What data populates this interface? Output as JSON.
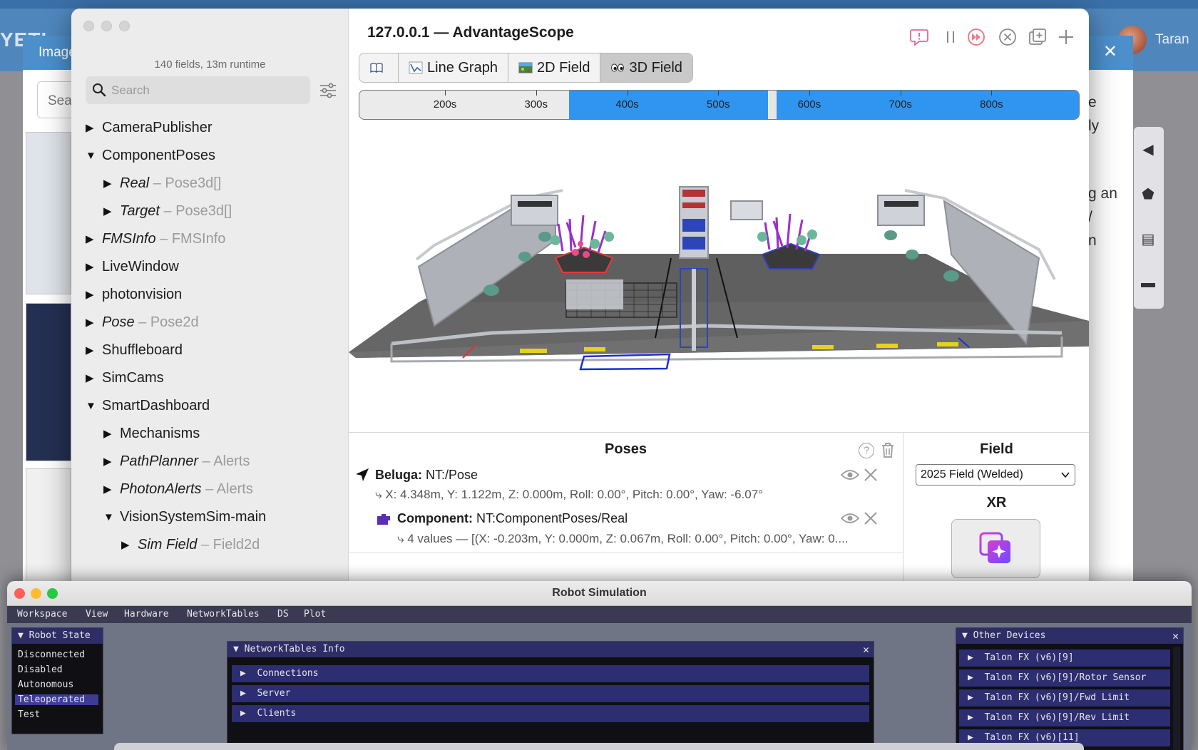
{
  "background_page": {
    "logo": "YETI",
    "user_name": "Taran",
    "modal_title": "Image",
    "modal_close": "✕",
    "search_placeholder": "Sea",
    "right_texts": [
      "e",
      "ly",
      "g an",
      "/",
      "n"
    ]
  },
  "advantagescope": {
    "title": "127.0.0.1 — AdvantageScope",
    "summary": "140 fields, 13m runtime",
    "search_placeholder": "Search",
    "tree": [
      {
        "name": "CameraPublisher",
        "type": "",
        "italic": false,
        "expanded": false,
        "depth": 0
      },
      {
        "name": "ComponentPoses",
        "type": "",
        "italic": false,
        "expanded": true,
        "depth": 0
      },
      {
        "name": "Real",
        "type": "– Pose3d[]",
        "italic": true,
        "expanded": false,
        "depth": 1
      },
      {
        "name": "Target",
        "type": "– Pose3d[]",
        "italic": true,
        "expanded": false,
        "depth": 1
      },
      {
        "name": "FMSInfo",
        "type": "– FMSInfo",
        "italic": true,
        "expanded": false,
        "depth": 0
      },
      {
        "name": "LiveWindow",
        "type": "",
        "italic": false,
        "expanded": false,
        "depth": 0
      },
      {
        "name": "photonvision",
        "type": "",
        "italic": false,
        "expanded": false,
        "depth": 0
      },
      {
        "name": "Pose",
        "type": "– Pose2d",
        "italic": true,
        "expanded": false,
        "depth": 0
      },
      {
        "name": "Shuffleboard",
        "type": "",
        "italic": false,
        "expanded": false,
        "depth": 0
      },
      {
        "name": "SimCams",
        "type": "",
        "italic": false,
        "expanded": false,
        "depth": 0
      },
      {
        "name": "SmartDashboard",
        "type": "",
        "italic": false,
        "expanded": true,
        "depth": 0
      },
      {
        "name": "Mechanisms",
        "type": "",
        "italic": false,
        "expanded": false,
        "depth": 1
      },
      {
        "name": "PathPlanner",
        "type": "– Alerts",
        "italic": true,
        "expanded": false,
        "depth": 1
      },
      {
        "name": "PhotonAlerts",
        "type": "– Alerts",
        "italic": true,
        "expanded": false,
        "depth": 1
      },
      {
        "name": "VisionSystemSim-main",
        "type": "",
        "italic": false,
        "expanded": true,
        "depth": 1
      },
      {
        "name": "Sim Field",
        "type": "– Field2d",
        "italic": true,
        "expanded": false,
        "depth": 2
      }
    ],
    "tabs": [
      {
        "label": "",
        "icon": "book-icon",
        "active": false
      },
      {
        "label": "Line Graph",
        "icon": "line-graph-icon",
        "active": false
      },
      {
        "label": "2D Field",
        "icon": "2d-field-icon",
        "active": false
      },
      {
        "label": "3D Field",
        "icon": "eyes-icon",
        "active": true
      }
    ],
    "timeline": {
      "ticks": [
        "200s",
        "300s",
        "400s",
        "500s",
        "600s",
        "700s",
        "800s"
      ],
      "tick_values": [
        200,
        300,
        400,
        500,
        600,
        700,
        800
      ],
      "view_start_s": 106,
      "view_end_s": 896,
      "enabled_ranges_s": [
        [
          336,
          555
        ],
        [
          564,
          896
        ]
      ],
      "cursor_s": 559,
      "colors": {
        "enabled": "#2f95f0",
        "disabled": "#ebebeb"
      }
    },
    "poses": {
      "title": "Poses",
      "items": [
        {
          "name": "Beluga:",
          "source": "NT:/Pose",
          "detail": "⤷ X: 4.348m, Y: 1.122m, Z: 0.000m, Roll: 0.00°, Pitch: 0.00°, Yaw: -6.07°",
          "icon": "robot-arrow-icon",
          "color": "#111111"
        },
        {
          "name": "Component:",
          "source": "NT:ComponentPoses/Real",
          "detail": "⤷ 4 values — [(X: -0.203m, Y: 0.000m, Z: 0.067m, Roll: 0.00°, Pitch: 0.00°, Yaw: 0....",
          "icon": "component-icon",
          "color": "#5b2fb5"
        }
      ]
    },
    "field": {
      "title": "Field",
      "selected": "2025 Field (Welded)",
      "xr_title": "XR"
    }
  },
  "robot_simulation": {
    "title": "Robot Simulation",
    "menu": [
      "Workspace",
      "View",
      "Hardware",
      "NetworkTables",
      "DS",
      "Plot"
    ],
    "robot_state": {
      "title": "Robot State",
      "options": [
        "Disconnected",
        "Disabled",
        "Autonomous",
        "Teleoperated",
        "Test"
      ],
      "selected": "Teleoperated"
    },
    "nt_info": {
      "title": "NetworkTables Info",
      "nodes": [
        "Connections",
        "Server",
        "Clients"
      ]
    },
    "other_devices": {
      "title": "Other Devices",
      "nodes": [
        "Talon FX (v6)[9]",
        "Talon FX (v6)[9]/Rotor Sensor",
        "Talon FX (v6)[9]/Fwd Limit",
        "Talon FX (v6)[9]/Rev Limit",
        "Talon FX (v6)[11]"
      ]
    }
  }
}
